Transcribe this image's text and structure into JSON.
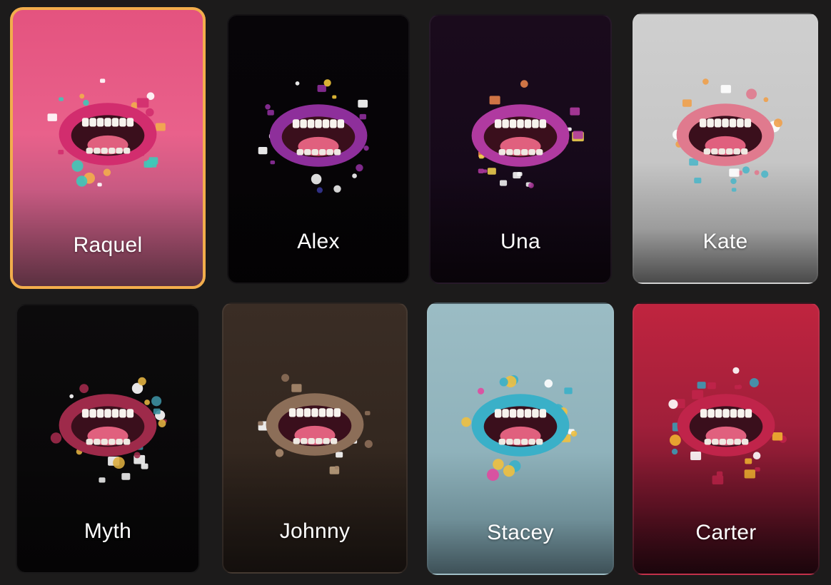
{
  "cards": [
    {
      "name": "Raquel",
      "selected": true,
      "palette": {
        "lip": "#d22d6e",
        "deco": "#3fc8b8",
        "accent": "#f2ad4c"
      }
    },
    {
      "name": "Alex",
      "selected": false,
      "palette": {
        "lip": "#8e2f9b",
        "deco": "#3a3aa0",
        "accent": "#f0c43a"
      }
    },
    {
      "name": "Una",
      "selected": false,
      "palette": {
        "lip": "#b03aa0",
        "deco": "#e37f4a",
        "accent": "#f0d050"
      }
    },
    {
      "name": "Kate",
      "selected": false,
      "palette": {
        "lip": "#e07a8e",
        "deco": "#4fb6c8",
        "accent": "#f0a04a"
      }
    },
    {
      "name": "Myth",
      "selected": false,
      "palette": {
        "lip": "#9e2a4a",
        "deco": "#3c8fa0",
        "accent": "#e0b040"
      }
    },
    {
      "name": "Johnny",
      "selected": false,
      "palette": {
        "lip": "#8c6e58",
        "deco": "#a88a6e",
        "accent": "#c4a684"
      }
    },
    {
      "name": "Stacey",
      "selected": false,
      "palette": {
        "lip": "#3ab0c8",
        "deco": "#e04aa0",
        "accent": "#f0c040"
      }
    },
    {
      "name": "Carter",
      "selected": false,
      "palette": {
        "lip": "#c0244a",
        "deco": "#3c9ab4",
        "accent": "#f0b030"
      }
    }
  ],
  "colors": {
    "background": "#1c1b1b",
    "selected_border": "#f2ad4c",
    "label_text": "#ffffff"
  }
}
